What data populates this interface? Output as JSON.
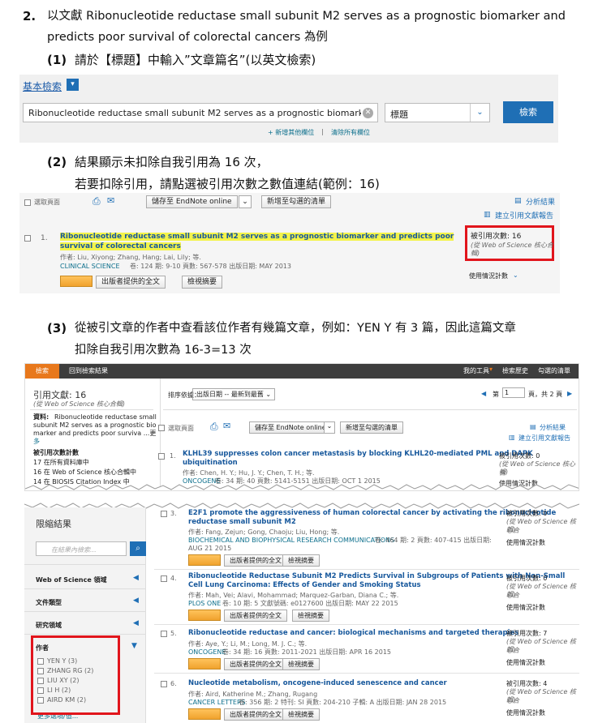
{
  "step2": {
    "number": "2.",
    "line1": "以文獻 Ribonucleotide reductase small subunit M2 serves as a prognostic biomarker and",
    "line2": "predicts poor survival of colorectal cancers 為例"
  },
  "sub1": {
    "number": "(1)",
    "text": "請於【標題】中輸入”文章篇名”(以英文檢索)"
  },
  "search": {
    "basic_label": "基本檢索",
    "query": "Ribonucleotide reductase small subunit M2 serves as a prognostic biomarker a",
    "field": "標題",
    "button": "檢索",
    "add_field": "+ 新增其他欄位",
    "clear_all": "清除所有欄位"
  },
  "sub2": {
    "number": "(2)",
    "line1": "結果顯示未扣除自我引用為 16 次，",
    "line2": "若要扣除引用，請點選被引用次數之數值連結(範例：16)"
  },
  "result1": {
    "select_page": "選取頁面",
    "save_endnote": "儲存至 EndNote online",
    "add_marked": "新增至勾選的清單",
    "analyze": "分析結果",
    "citation_report": "建立引用文獻報告",
    "index": "1.",
    "title_line1": "Ribonucleotide reductase small subunit M2 serves as a prognostic biomarker and predicts poor",
    "title_line2": "survival of colorectal cancers",
    "authors": "作者: Liu, Xiyong; Zhang, Hang; Lai, Lily; 等.",
    "journal": "CLINICAL SCIENCE",
    "meta": "卷: 124   期: 9-10   頁數: 567-578   出版日期: MAY 2013",
    "full_text": "出版者提供的全文",
    "abstract": "檢視摘要",
    "cited_label": "被引用次數: 16",
    "cited_source": "(從 Web of Science 核心合",
    "cited_source2": "輯)",
    "usage": "使用情況計數"
  },
  "sub3": {
    "number": "(3)",
    "line1": "從被引文章的作者中查看該位作者有幾篇文章，例如：YEN Y 有 3 篇，因此這篇文章",
    "line2": "扣除自我引用次數為 16-3=13 次"
  },
  "wos": {
    "tab_search": "檢索",
    "back_results": "回到檢索結果",
    "my_tools": "我的工具",
    "search_history": "檢索歷史",
    "marked_list": "勾選的清單",
    "cited_count": "引用文獻: 16",
    "cited_source": "(從 Web of Science 核心合輯)",
    "source_label": "資料:",
    "source_text1": "Ribonucleotide reductase small",
    "source_text2": "subunit M2 serves as a prognostic bio",
    "source_text3": "marker and predicts poor surviva ...更",
    "source_text4": "多",
    "cited_counts_title": "被引用次數計數",
    "count1": "17 在所有資料庫中",
    "count2": "16 在 Web of Science 核心合輯中",
    "count3": "14 在 BIOSIS Citation Index 中",
    "sort_label": "排序依據：",
    "sort_value": "出版日期 -- 最新到最舊",
    "page_label": "第",
    "page_value": "1",
    "page_of": "頁，共 2 頁",
    "select_page": "選取頁面",
    "save_endnote": "儲存至 EndNote online",
    "add_marked": "新增至勾選的清單",
    "analyze": "分析結果",
    "citation_report": "建立引用文獻報告",
    "refine_title": "限縮結果",
    "refine_placeholder": "在結果內檢索...",
    "facets": [
      "Web of Science 領域",
      "文件類型",
      "研究領域"
    ],
    "author_facet": "作者",
    "authors": [
      "YEN Y (3)",
      "ZHANG RG (2)",
      "LIU XY (2)",
      "LI H (2)",
      "AIRD KM (2)"
    ],
    "more_options": "更多選項/值...",
    "full_text": "出版者提供的全文",
    "abstract": "檢視摘要",
    "cited_label_prefix": "被引用次數",
    "usage": "使用情況計數",
    "records": [
      {
        "index": "1.",
        "title1": "KLHL39 suppresses colon cancer metastasis by blocking KLHL20-mediated PML and DAPK",
        "title2": "ubiquitination",
        "authors": "作者: Chen, H. Y.; Hu, J. Y.; Chen, T. H.; 等.",
        "journal": "ONCOGENE",
        "meta": "卷: 34   期: 40   頁數: 5141-5151   出版日期: OCT 1 2015",
        "cited": "被引用次數: 0",
        "source": "(從 Web of Science 核心合",
        "source2": "輯)"
      },
      {
        "index": "3.",
        "title1": "E2F1 promote the aggressiveness of human colorectal cancer by activating the ribonucleotide",
        "title2": "reductase small subunit M2",
        "authors": "作者: Fang, Zejun; Gong, Chaoju; Liu, Hong; 等.",
        "journal": "BIOCHEMICAL AND BIOPHYSICAL RESEARCH COMMUNICATIONS",
        "meta": "卷: 464   期: 2   頁數: 407-415   出版日期:",
        "meta2": "AUG 21 2015",
        "cited": "被引用次數: 0",
        "source": "(從 Web of Science 核心合",
        "source2": "輯)"
      },
      {
        "index": "4.",
        "title1": "Ribonucleotide Reductase Subunit M2 Predicts Survival in Subgroups of Patients with Non-Small",
        "title2": "Cell Lung Carcinoma: Effects of Gender and Smoking Status",
        "authors": "作者: Mah, Vei; Alavi, Mohammad; Marquez-Garban, Diana C.; 等.",
        "journal": "PLOS ONE",
        "meta": "卷: 10   期: 5   文獻號碼: e0127600   出版日期: MAY 22 2015",
        "cited": "被引用次數: 0",
        "source": "(從 Web of Science 核心合",
        "source2": "輯)"
      },
      {
        "index": "5.",
        "title1": "Ribonucleotide reductase and cancer: biological mechanisms and targeted therapies",
        "title2": "",
        "authors": "作者: Aye, Y.; Li, M.; Long, M. J. C.; 等.",
        "journal": "ONCOGENE",
        "meta": "卷: 34   期: 16   頁數: 2011-2021   出版日期: APR 16 2015",
        "cited": "被引用次數: 7",
        "source": "(從 Web of Science 核心合",
        "source2": "輯)"
      },
      {
        "index": "6.",
        "title1": "Nucleotide metabolism, oncogene-induced senescence and cancer",
        "title2": "",
        "authors": "作者: Aird, Katherine M.; Zhang, Rugang",
        "journal": "CANCER LETTERS",
        "meta": "卷: 356   期: 2   特刊: SI   頁數: 204-210   子輯: A   出版日期: JAN 28 2015",
        "cited": "被引用次數: 4",
        "source": "(從 Web of Science 核心合",
        "source2": "輯)"
      }
    ]
  },
  "colors": {
    "wos_orange": "#e8781c",
    "red_box": "#e1151c",
    "link_blue": "#17589c",
    "search_btn": "#1f6fb5"
  }
}
